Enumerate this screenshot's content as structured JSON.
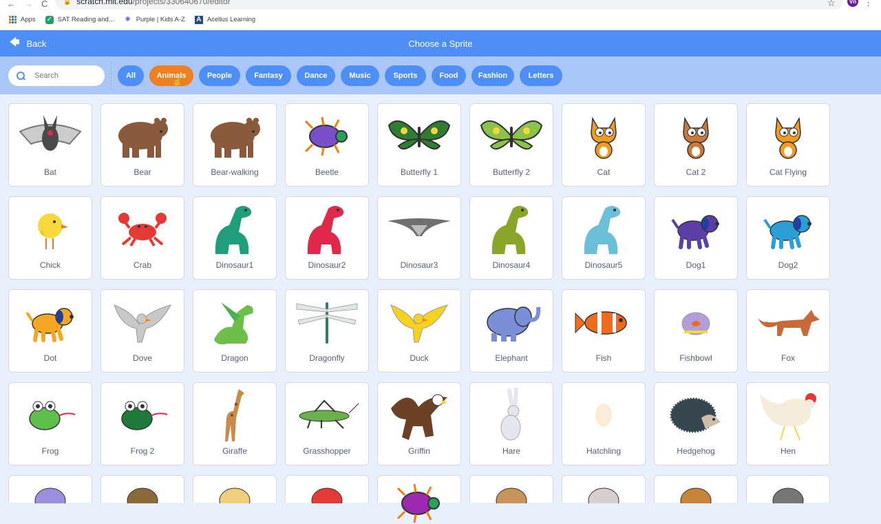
{
  "browser": {
    "nav": {
      "back": "←",
      "forward": "→",
      "reload": "C"
    },
    "url_host": "scratch.mit.edu",
    "url_path": "/projects/330640670/editor",
    "avatar_initials": "Vn",
    "bookmarks": [
      {
        "label": "Apps",
        "icon": "apps-grid-icon"
      },
      {
        "label": "SAT Reading and...",
        "icon": "sat-shield-icon"
      },
      {
        "label": "Purple | Kids A-Z",
        "icon": "purple-burst-icon"
      },
      {
        "label": "Acellus Learning",
        "icon": "acellus-a-icon"
      }
    ]
  },
  "header": {
    "back_label": "Back",
    "title": "Choose a Sprite"
  },
  "filter": {
    "search_placeholder": "Search",
    "tags": [
      {
        "label": "All",
        "active": false
      },
      {
        "label": "Animals",
        "active": true
      },
      {
        "label": "People",
        "active": false
      },
      {
        "label": "Fantasy",
        "active": false
      },
      {
        "label": "Dance",
        "active": false
      },
      {
        "label": "Music",
        "active": false
      },
      {
        "label": "Sports",
        "active": false
      },
      {
        "label": "Food",
        "active": false
      },
      {
        "label": "Fashion",
        "active": false
      },
      {
        "label": "Letters",
        "active": false
      }
    ]
  },
  "colors": {
    "header_blue": "#4d8ff7",
    "filter_bar": "#a9c8f7",
    "active_tag": "#f07f1d",
    "background": "#e8f0fc",
    "label_text": "#575e75"
  },
  "sprites": [
    {
      "name": "Bat",
      "icon": "bat",
      "color": "#4a4a4a"
    },
    {
      "name": "Bear",
      "icon": "bear",
      "color": "#8b5a3c"
    },
    {
      "name": "Bear-walking",
      "icon": "bear",
      "color": "#8b5a3c"
    },
    {
      "name": "Beetle",
      "icon": "beetle",
      "color": "#7b4fc9"
    },
    {
      "name": "Butterfly 1",
      "icon": "butterfly",
      "color": "#2e7d32"
    },
    {
      "name": "Butterfly 2",
      "icon": "butterfly",
      "color": "#8bc34a"
    },
    {
      "name": "Cat",
      "icon": "cat",
      "color": "#f29b21"
    },
    {
      "name": "Cat 2",
      "icon": "cat",
      "color": "#c97a3a"
    },
    {
      "name": "Cat Flying",
      "icon": "cat",
      "color": "#f29b21"
    },
    {
      "name": "Chick",
      "icon": "chick",
      "color": "#f7d83b"
    },
    {
      "name": "Crab",
      "icon": "crab",
      "color": "#e53935"
    },
    {
      "name": "Dinosaur1",
      "icon": "dino",
      "color": "#1e9e7a"
    },
    {
      "name": "Dinosaur2",
      "icon": "dino",
      "color": "#e0284a"
    },
    {
      "name": "Dinosaur3",
      "icon": "ptero",
      "color": "#707070"
    },
    {
      "name": "Dinosaur4",
      "icon": "dino",
      "color": "#8aa62a"
    },
    {
      "name": "Dinosaur5",
      "icon": "dino",
      "color": "#6bbfd9"
    },
    {
      "name": "Dog1",
      "icon": "dog",
      "color": "#5b3fa6"
    },
    {
      "name": "Dog2",
      "icon": "dog",
      "color": "#2a9fd6"
    },
    {
      "name": "Dot",
      "icon": "dog",
      "color": "#f5a623"
    },
    {
      "name": "Dove",
      "icon": "bird",
      "color": "#c8c8c8"
    },
    {
      "name": "Dragon",
      "icon": "dragon",
      "color": "#6cc04a"
    },
    {
      "name": "Dragonfly",
      "icon": "dragonfly",
      "color": "#2e7d6b"
    },
    {
      "name": "Duck",
      "icon": "bird",
      "color": "#f7d21e"
    },
    {
      "name": "Elephant",
      "icon": "elephant",
      "color": "#7b8fd6"
    },
    {
      "name": "Fish",
      "icon": "fish",
      "color": "#f26a1b"
    },
    {
      "name": "Fishbowl",
      "icon": "fishbowl",
      "color": "#b39ddb"
    },
    {
      "name": "Fox",
      "icon": "fox",
      "color": "#c8693a"
    },
    {
      "name": "Frog",
      "icon": "frog",
      "color": "#5cc04a"
    },
    {
      "name": "Frog 2",
      "icon": "frog",
      "color": "#1d7a3a"
    },
    {
      "name": "Giraffe",
      "icon": "giraffe",
      "color": "#c98a4a"
    },
    {
      "name": "Grasshopper",
      "icon": "grasshopper",
      "color": "#6ab04c"
    },
    {
      "name": "Griffin",
      "icon": "griffin",
      "color": "#6b4226"
    },
    {
      "name": "Hare",
      "icon": "hare",
      "color": "#e6e6ee"
    },
    {
      "name": "Hatchling",
      "icon": "egg",
      "color": "#fbecd8"
    },
    {
      "name": "Hedgehog",
      "icon": "hedgehog",
      "color": "#37474f"
    },
    {
      "name": "Hen",
      "icon": "hen",
      "color": "#f5ecd9"
    }
  ],
  "partial_row": [
    {
      "icon": "hippo",
      "color": "#9b8fe0"
    },
    {
      "icon": "horse",
      "color": "#8b6a3a"
    },
    {
      "icon": "jellyfish",
      "color": "#f0cf7a"
    },
    {
      "icon": "ladybug",
      "color": "#e53935"
    },
    {
      "icon": "beetle",
      "color": "#9c27b0"
    },
    {
      "icon": "lion",
      "color": "#c9955a"
    },
    {
      "icon": "llama",
      "color": "#d9cfd0"
    },
    {
      "icon": "monkey",
      "color": "#c9843a"
    },
    {
      "icon": "mouse",
      "color": "#777777"
    }
  ]
}
